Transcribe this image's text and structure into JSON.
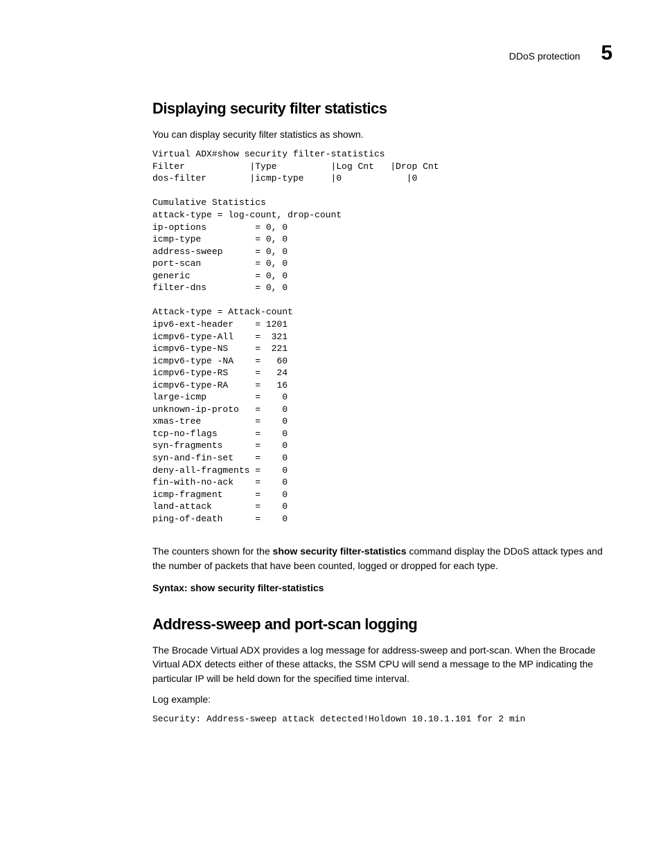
{
  "header": {
    "label": "DDoS protection",
    "chapter": "5"
  },
  "section1": {
    "title": "Displaying security filter statistics",
    "intro": "You can display security filter statistics as shown.",
    "code": "Virtual ADX#show security filter-statistics\nFilter            |Type          |Log Cnt   |Drop Cnt\ndos-filter        |icmp-type     |0            |0\n\nCumulative Statistics\nattack-type = log-count, drop-count\nip-options         = 0, 0\nicmp-type          = 0, 0\naddress-sweep      = 0, 0\nport-scan          = 0, 0\ngeneric            = 0, 0\nfilter-dns         = 0, 0\n\nAttack-type = Attack-count\nipv6-ext-header    = 1201\nicmpv6-type-All    =  321\nicmpv6-type-NS     =  221\nicmpv6-type -NA    =   60\nicmpv6-type-RS     =   24\nicmpv6-type-RA     =   16\nlarge-icmp         =    0\nunknown-ip-proto   =    0\nxmas-tree          =    0\ntcp-no-flags       =    0\nsyn-fragments      =    0\nsyn-and-fin-set    =    0\ndeny-all-fragments =    0\nfin-with-no-ack    =    0\nicmp-fragment      =    0\nland-attack        =    0\nping-of-death      =    0",
    "explain_pre": "The counters shown for the ",
    "explain_cmd": "show security filter-statistics",
    "explain_post": " command display the DDoS attack types and the number of packets that have been counted, logged or dropped for each type.",
    "syntax_label": "Syntax:  ",
    "syntax_cmd": "show security filter-statistics"
  },
  "section2": {
    "title": "Address-sweep and port-scan logging",
    "para": "The Brocade Virtual ADX provides a log message for address-sweep and port-scan. When the Brocade Virtual ADX detects either of these attacks, the SSM CPU will send a message to the MP indicating the particular IP will be held down for the specified time interval.",
    "log_label": "Log example:",
    "code": "Security: Address-sweep attack detected!Holdown 10.10.1.101 for 2 min"
  }
}
